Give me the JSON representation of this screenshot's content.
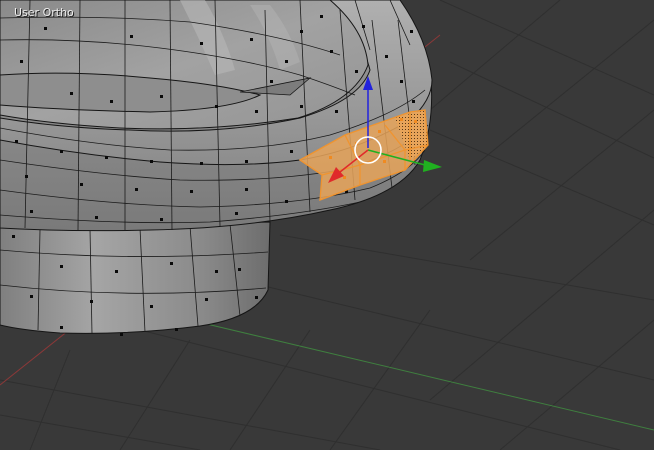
{
  "viewport": {
    "view_label": "User Ortho",
    "colors": {
      "background": "#393939",
      "grid_line": "#2f2f2f",
      "x_axis": "#8b3838",
      "y_axis": "#3f7f3f",
      "mesh_face": "#9a9a9a",
      "mesh_edge": "#151515",
      "vertex": "#0a0a0a",
      "selection": "#f0942f",
      "gizmo_x": "#e02a2a",
      "gizmo_y": "#20b020",
      "gizmo_z": "#2222dd",
      "cursor_ring": "#ffffff"
    },
    "icons": [
      "translate-gizmo-x-arrow-icon",
      "translate-gizmo-y-arrow-icon",
      "translate-gizmo-z-arrow-icon",
      "gizmo-center-ring-icon"
    ]
  }
}
